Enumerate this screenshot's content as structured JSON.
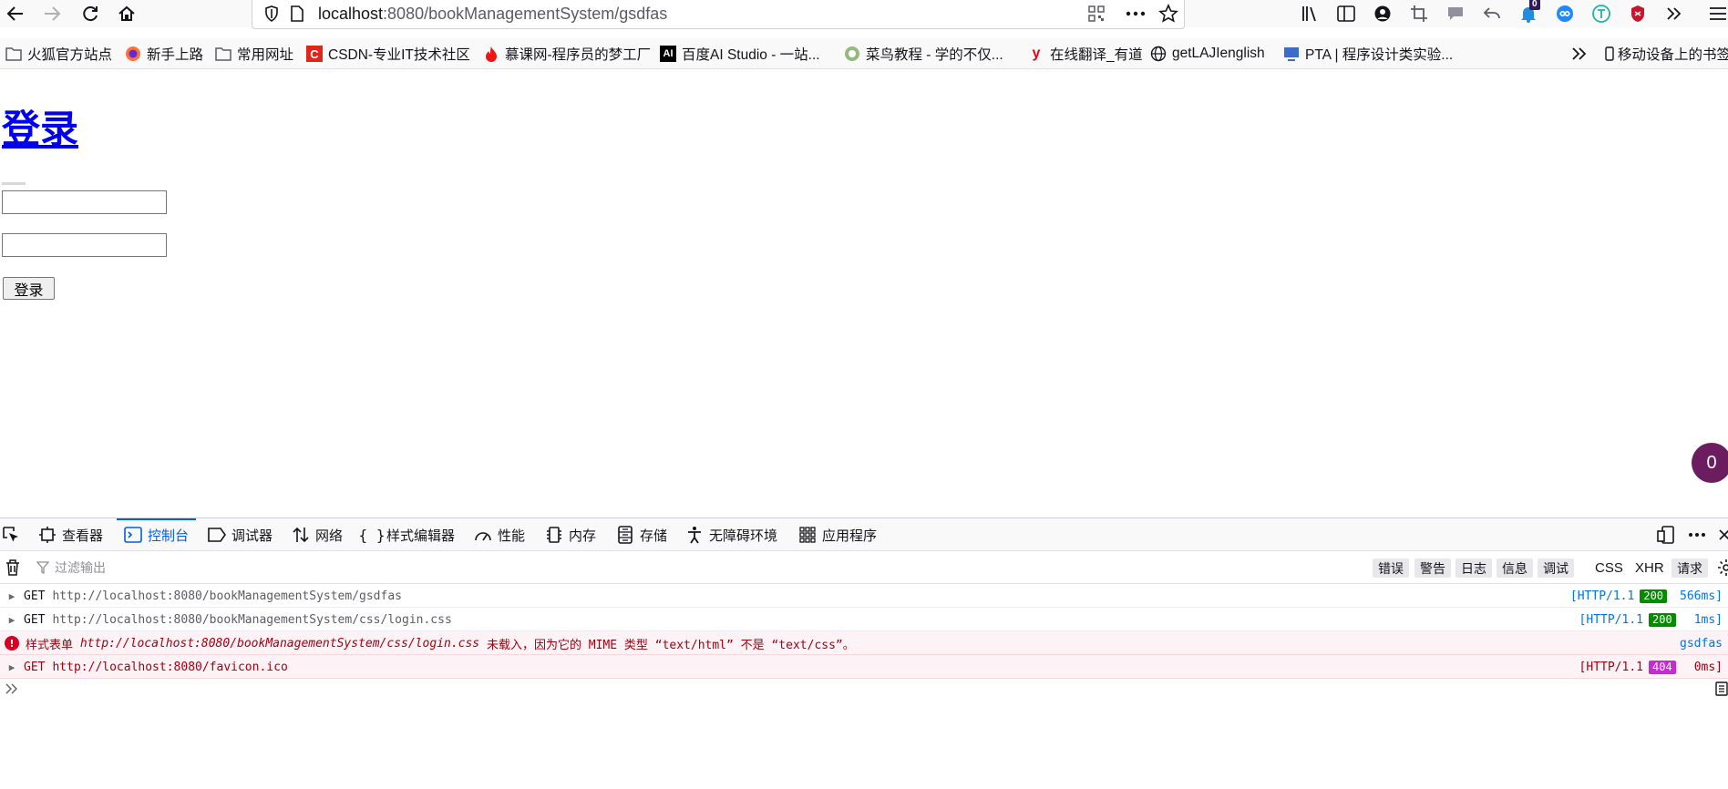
{
  "browser": {
    "url_host": "localhost",
    "url_rest": ":8080/bookManagementSystem/gsdfas",
    "notification_count": "0",
    "bookmarks": [
      {
        "label": "火狐官方站点",
        "icon": "folder-icon"
      },
      {
        "label": "新手上路",
        "icon": "firefox-icon"
      },
      {
        "label": "常用网址",
        "icon": "folder-icon"
      },
      {
        "label": "CSDN-专业IT技术社区",
        "icon": "csdn-icon"
      },
      {
        "label": "慕课网-程序员的梦工厂",
        "icon": "flame-icon"
      },
      {
        "label": "百度AI Studio - 一站...",
        "icon": "ai-icon"
      },
      {
        "label": "菜鸟教程 - 学的不仅...",
        "icon": "runoob-icon"
      },
      {
        "label": "在线翻译_有道",
        "icon": "youdao-icon"
      },
      {
        "label": "getLAJIenglish",
        "icon": "globe-icon"
      },
      {
        "label": "PTA | 程序设计类实验...",
        "icon": "pta-icon"
      }
    ],
    "mobile_bookmarks": "移动设备上的书签"
  },
  "page": {
    "title": "登录",
    "login_button": "登录",
    "floating_badge": "0"
  },
  "devtools": {
    "tabs": [
      {
        "label": "查看器",
        "icon": "inspector-icon"
      },
      {
        "label": "控制台",
        "icon": "console-icon",
        "active": true
      },
      {
        "label": "调试器",
        "icon": "debugger-icon"
      },
      {
        "label": "网络",
        "icon": "network-icon"
      },
      {
        "label": "样式编辑器",
        "icon": "style-editor-icon"
      },
      {
        "label": "性能",
        "icon": "performance-icon"
      },
      {
        "label": "内存",
        "icon": "memory-icon"
      },
      {
        "label": "存储",
        "icon": "storage-icon"
      },
      {
        "label": "无障碍环境",
        "icon": "accessibility-icon"
      },
      {
        "label": "应用程序",
        "icon": "application-icon"
      }
    ],
    "filter_placeholder": "过滤输出",
    "levels": [
      "错误",
      "警告",
      "日志",
      "信息",
      "调试"
    ],
    "categories": [
      {
        "label": "CSS",
        "pressed": false
      },
      {
        "label": "XHR",
        "pressed": false
      },
      {
        "label": "请求",
        "pressed": true
      }
    ],
    "rows": [
      {
        "method": "GET",
        "url": "http://localhost:8080/bookManagementSystem/gsdfas",
        "protocol": "[HTTP/1.1",
        "status": "200",
        "time": "566ms]"
      },
      {
        "method": "GET",
        "url": "http://localhost:8080/bookManagementSystem/css/login.css",
        "protocol": "[HTTP/1.1",
        "status": "200",
        "time": "1ms]"
      },
      {
        "prefix": "样式表单 ",
        "url": "http://localhost:8080/bookManagementSystem/css/login.css",
        "suffix": " 未载入，因为它的 MIME 类型 “text/html” 不是 “text/css”。",
        "source": "gsdfas"
      },
      {
        "method": "GET",
        "url": "http://localhost:8080/favicon.ico",
        "protocol": "[HTTP/1.1",
        "status": "404",
        "time": "0ms]"
      }
    ]
  },
  "colors": {
    "accent": "#0060df",
    "link": "#0000ee",
    "error_bg": "#fdf2f5",
    "error_text": "#a4000f",
    "status_ok": "#058b00",
    "status_404": "#c62ad1",
    "badge": "#6c1d5f"
  }
}
